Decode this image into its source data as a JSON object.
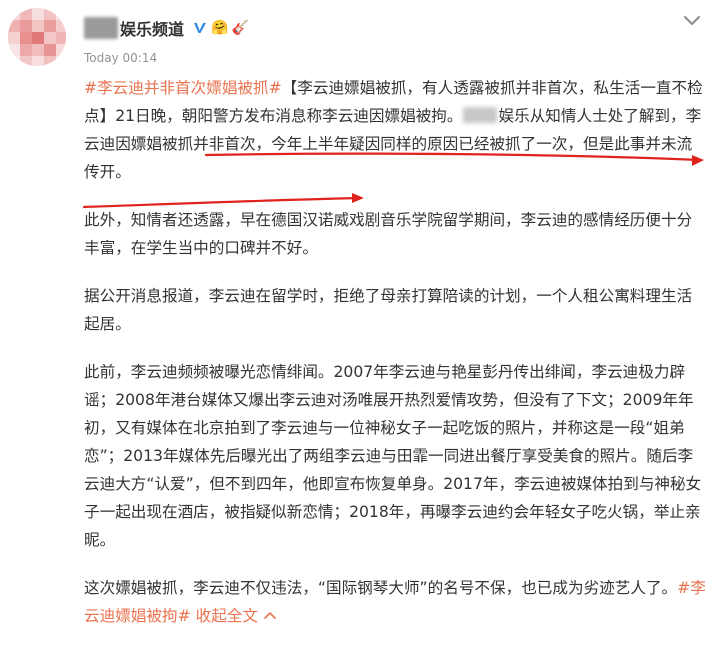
{
  "post": {
    "author_suffix": "娱乐频道",
    "time": "Today 00:14",
    "paragraphs": [
      {
        "tag_open": "#李云迪并非首次嫖娼被抓#",
        "line1": "【李云迪嫖娼被抓，有人透露被抓并非首次，私生活一直不检点】21日晚，朝阳警方发布消息称李云迪因嫖娼被拘。",
        "line2": "娱乐从知情人士处了解到，李云迪因嫖娼被抓并非首次，今年上半年疑因同样的原因已经被抓了一次，但是此事并未流传开。"
      },
      {
        "text": "此外，知情者还透露，早在德国汉诺威戏剧音乐学院留学期间，李云迪的感情经历便十分丰富，在学生当中的口碑并不好。"
      },
      {
        "text": "据公开消息报道，李云迪在留学时，拒绝了母亲打算陪读的计划，一个人租公寓料理生活起居。"
      },
      {
        "text": "此前，李云迪频频被曝光恋情绯闻。2007年李云迪与艳星彭丹传出绯闻，李云迪极力辟谣；2008年港台媒体又爆出李云迪对汤唯展开热烈爱情攻势，但没有了下文；2009年年初，又有媒体在北京拍到了李云迪与一位神秘女子一起吃饭的照片，并称这是一段“姐弟恋”；2013年媒体先后曝光出了两组李云迪与田霏一同进出餐厅享受美食的照片。随后李云迪大方“认爱”，但不到四年，他即宣布恢复单身。2017年，李云迪被媒体拍到与神秘女子一起出现在酒店，被指疑似新恋情；2018年，再曝李云迪约会年轻女子吃火锅，举止亲昵。"
      },
      {
        "text": "这次嫖娼被抓，李云迪不仅违法，“国际钢琴大师”的名号不保，也已成为劣迹艺人了。",
        "tag_close": "#李云迪嫖娼被拘#",
        "collapse_label": "收起全文"
      }
    ]
  },
  "colors": {
    "link": "#eb7350",
    "annotation": "#e0231c",
    "text": "#333333",
    "meta": "#939393"
  },
  "icons": {
    "verified": "verified-v-icon",
    "emoji": [
      "hug-emoji-icon",
      "guitar-emoji-icon"
    ],
    "menu": "chevron-down-icon",
    "collapse": "chevron-up-icon"
  }
}
